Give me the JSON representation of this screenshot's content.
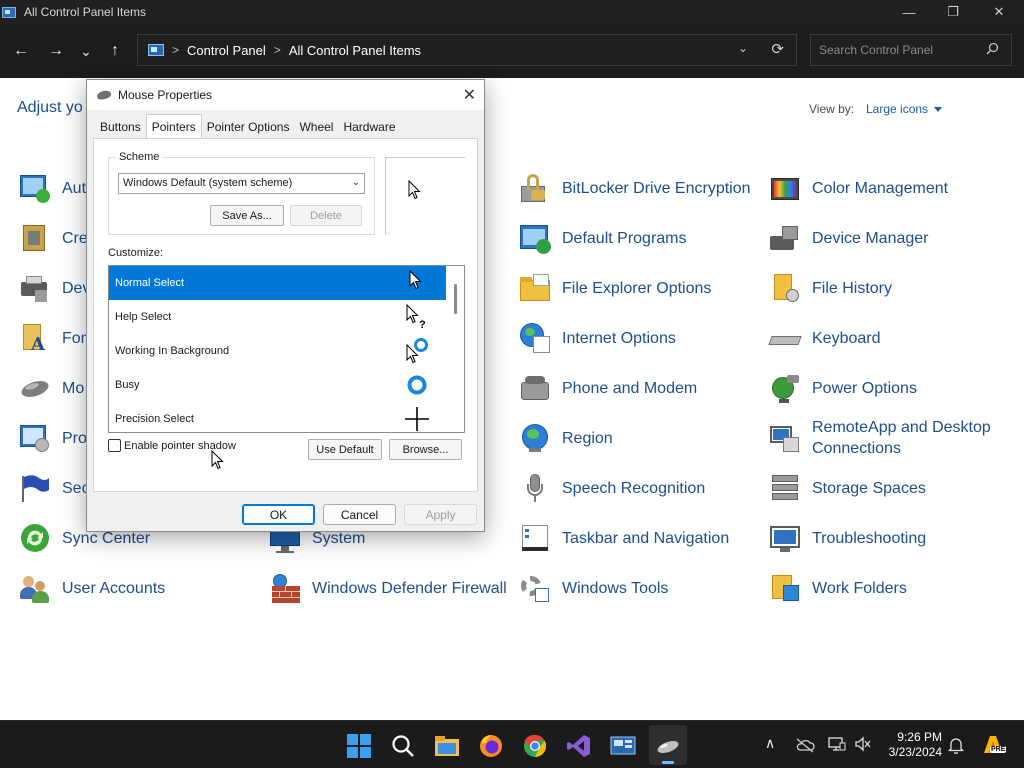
{
  "window": {
    "title": "All Control Panel Items",
    "minimize_glyph": "—",
    "maximize_glyph": "❐",
    "close_glyph": "✕"
  },
  "nav": {
    "back_glyph": "←",
    "forward_glyph": "→",
    "recent_glyph": "⌄",
    "up_glyph": "↑",
    "breadcrumb": [
      "Control Panel",
      "All Control Panel Items"
    ],
    "breadcrumb_sep": ">",
    "address_dropdown_glyph": "⌄",
    "refresh_glyph": "⟳",
    "search_placeholder": "Search Control Panel"
  },
  "content": {
    "heading": "Adjust yo",
    "view_by_label": "View by:",
    "view_by_value": "Large icons",
    "items": [
      {
        "label": "Aut",
        "icon": "autoplay-icon"
      },
      {
        "label": "Cre",
        "icon": "credential-manager-icon"
      },
      {
        "label": "Dev",
        "icon": "devices-printers-icon"
      },
      {
        "label": "Fon",
        "icon": "fonts-icon"
      },
      {
        "label": "Mo",
        "icon": "mouse-icon"
      },
      {
        "label": "Pro",
        "icon": "programs-features-icon"
      },
      {
        "label": "Sec",
        "icon": "security-maintenance-icon"
      },
      {
        "label": "Sync Center",
        "icon": "sync-center-icon"
      },
      {
        "label": "User Accounts",
        "icon": "user-accounts-icon"
      },
      {
        "label": "System",
        "icon": "system-icon"
      },
      {
        "label": "Windows Defender Firewall",
        "icon": "firewall-icon"
      },
      {
        "label": "BitLocker Drive Encryption",
        "icon": "bitlocker-icon"
      },
      {
        "label": "Default Programs",
        "icon": "default-programs-icon"
      },
      {
        "label": "File Explorer Options",
        "icon": "file-explorer-options-icon"
      },
      {
        "label": "Internet Options",
        "icon": "internet-options-icon"
      },
      {
        "label": "Phone and Modem",
        "icon": "phone-modem-icon"
      },
      {
        "label": "Region",
        "icon": "region-icon"
      },
      {
        "label": "Speech Recognition",
        "icon": "microphone-icon"
      },
      {
        "label": "Taskbar and Navigation",
        "icon": "taskbar-icon"
      },
      {
        "label": "Windows Tools",
        "icon": "windows-tools-icon"
      },
      {
        "label": "Color Management",
        "icon": "color-management-icon"
      },
      {
        "label": "Device Manager",
        "icon": "device-manager-icon"
      },
      {
        "label": "File History",
        "icon": "file-history-icon"
      },
      {
        "label": "Keyboard",
        "icon": "keyboard-icon"
      },
      {
        "label": "Power Options",
        "icon": "power-options-icon"
      },
      {
        "label": "RemoteApp and Desktop Connections",
        "icon": "remoteapp-icon"
      },
      {
        "label": "Storage Spaces",
        "icon": "storage-spaces-icon"
      },
      {
        "label": "Troubleshooting",
        "icon": "troubleshooting-icon"
      },
      {
        "label": "Work Folders",
        "icon": "work-folders-icon"
      }
    ]
  },
  "dialog": {
    "title": "Mouse Properties",
    "close_glyph": "✕",
    "tabs": [
      "Buttons",
      "Pointers",
      "Pointer Options",
      "Wheel",
      "Hardware"
    ],
    "active_tab": "Pointers",
    "scheme_label": "Scheme",
    "scheme_value": "Windows Default (system scheme)",
    "scheme_dropdown_glyph": "⌄",
    "save_as_label": "Save As...",
    "delete_label": "Delete",
    "customize_label": "Customize:",
    "cursors": [
      {
        "name": "Normal Select",
        "selected": true,
        "icon": "arrow-cursor-icon"
      },
      {
        "name": "Help Select",
        "selected": false,
        "icon": "help-cursor-icon"
      },
      {
        "name": "Working In Background",
        "selected": false,
        "icon": "working-cursor-icon"
      },
      {
        "name": "Busy",
        "selected": false,
        "icon": "busy-cursor-icon"
      },
      {
        "name": "Precision Select",
        "selected": false,
        "icon": "crosshair-cursor-icon"
      }
    ],
    "shadow_label": "Enable pointer shadow",
    "shadow_checked": false,
    "use_default_label": "Use Default",
    "browse_label": "Browse...",
    "ok_label": "OK",
    "cancel_label": "Cancel",
    "apply_label": "Apply"
  },
  "taskbar": {
    "apps": [
      "start-icon",
      "search-icon",
      "file-explorer-icon",
      "firefox-icon",
      "chrome-icon",
      "visual-studio-icon",
      "control-panel-icon",
      "mouse-properties-icon"
    ],
    "tray_chevron": "∧",
    "time": "9:26 PM",
    "date": "3/23/2024",
    "badge": "PRE"
  }
}
